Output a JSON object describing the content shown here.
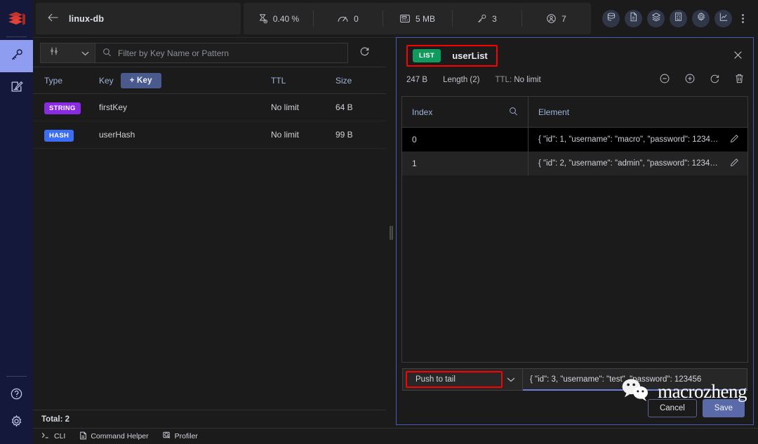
{
  "rail": {
    "logo_icon": "redis-logo-icon",
    "items": [
      {
        "name": "browser",
        "icon": "key-icon",
        "active": true
      },
      {
        "name": "workbench",
        "icon": "edit-note-icon",
        "active": false
      }
    ],
    "bottom_items": [
      {
        "name": "help",
        "icon": "help-circle-icon"
      },
      {
        "name": "settings",
        "icon": "gear-icon"
      }
    ]
  },
  "header": {
    "back_icon": "arrow-left-icon",
    "db_name": "linux-db",
    "metrics": [
      {
        "icon": "cpu-icon",
        "label": "0.40 %"
      },
      {
        "icon": "gauge-icon",
        "label": "0"
      },
      {
        "icon": "memory-icon",
        "label": "5 MB"
      },
      {
        "icon": "key-icon",
        "label": "3"
      },
      {
        "icon": "user-icon",
        "label": "7"
      }
    ],
    "tools": [
      {
        "name": "tool-overview",
        "icon": "database-overview-icon"
      },
      {
        "name": "tool-docs",
        "icon": "document-icon"
      },
      {
        "name": "tool-tutorials",
        "icon": "layers-icon"
      },
      {
        "name": "tool-calculator",
        "icon": "grid-icon"
      },
      {
        "name": "tool-settings",
        "icon": "gear-icon"
      },
      {
        "name": "tool-analytics",
        "icon": "chart-icon"
      },
      {
        "name": "tool-more",
        "icon": "kebab-menu-icon"
      }
    ]
  },
  "browser": {
    "sort_icon": "filter-sliders-icon",
    "sort_caret_icon": "chevron-down-icon",
    "search_icon": "search-icon",
    "search_placeholder": "Filter by Key Name or Pattern",
    "search_value": "",
    "refresh_icon": "refresh-icon",
    "columns": {
      "type": "Type",
      "key": "Key",
      "ttl": "TTL",
      "size": "Size"
    },
    "add_key_label": "+ Key",
    "rows": [
      {
        "type": "STRING",
        "type_color": "#8a2be2",
        "key": "firstKey",
        "ttl": "No limit",
        "size": "64 B"
      },
      {
        "type": "HASH",
        "type_color": "#3b6ef5",
        "key": "userHash",
        "ttl": "No limit",
        "size": "99 B"
      }
    ],
    "total_label": "Total: 2"
  },
  "details": {
    "type_badge": "LIST",
    "type_badge_color": "#119a5e",
    "key_name": "userList",
    "close_icon": "close-icon",
    "size": "247 B",
    "length": "Length (2)",
    "ttl_label": "TTL:",
    "ttl_value": "No limit",
    "actions": [
      {
        "name": "remove-element-button",
        "icon": "minus-circle-icon"
      },
      {
        "name": "add-element-button",
        "icon": "plus-circle-icon"
      },
      {
        "name": "refresh-button",
        "icon": "refresh-icon"
      },
      {
        "name": "delete-key-button",
        "icon": "trash-icon"
      }
    ],
    "table": {
      "col_index": "Index",
      "col_index_search_icon": "search-icon",
      "col_element": "Element",
      "rows": [
        {
          "index": "0",
          "element": "{ \"id\": 1, \"username\": \"macro\", \"password\": 1234…",
          "edit_icon": "pencil-icon"
        },
        {
          "index": "1",
          "element": "{ \"id\": 2, \"username\": \"admin\", \"password\": 1234…",
          "edit_icon": "pencil-icon"
        }
      ]
    },
    "add_form": {
      "destination": "Push to tail",
      "destination_caret_icon": "chevron-down-icon",
      "value": "{    \"id\": 3,    \"username\": \"test\",     \"password\": 123456",
      "cancel_label": "Cancel",
      "save_label": "Save"
    }
  },
  "watermark": {
    "icon": "wechat-icon",
    "text": "macrozheng"
  },
  "footer": {
    "items": [
      {
        "name": "cli",
        "icon": "terminal-icon",
        "label": "CLI"
      },
      {
        "name": "command-helper",
        "icon": "document-icon",
        "label": "Command Helper"
      },
      {
        "name": "profiler",
        "icon": "profiler-icon",
        "label": "Profiler"
      }
    ]
  },
  "colors": {
    "accent_blue": "#4a5bb5",
    "highlight_red": "#ff0000",
    "rail_bg": "#14183a",
    "rail_active": "#8e9df0"
  }
}
